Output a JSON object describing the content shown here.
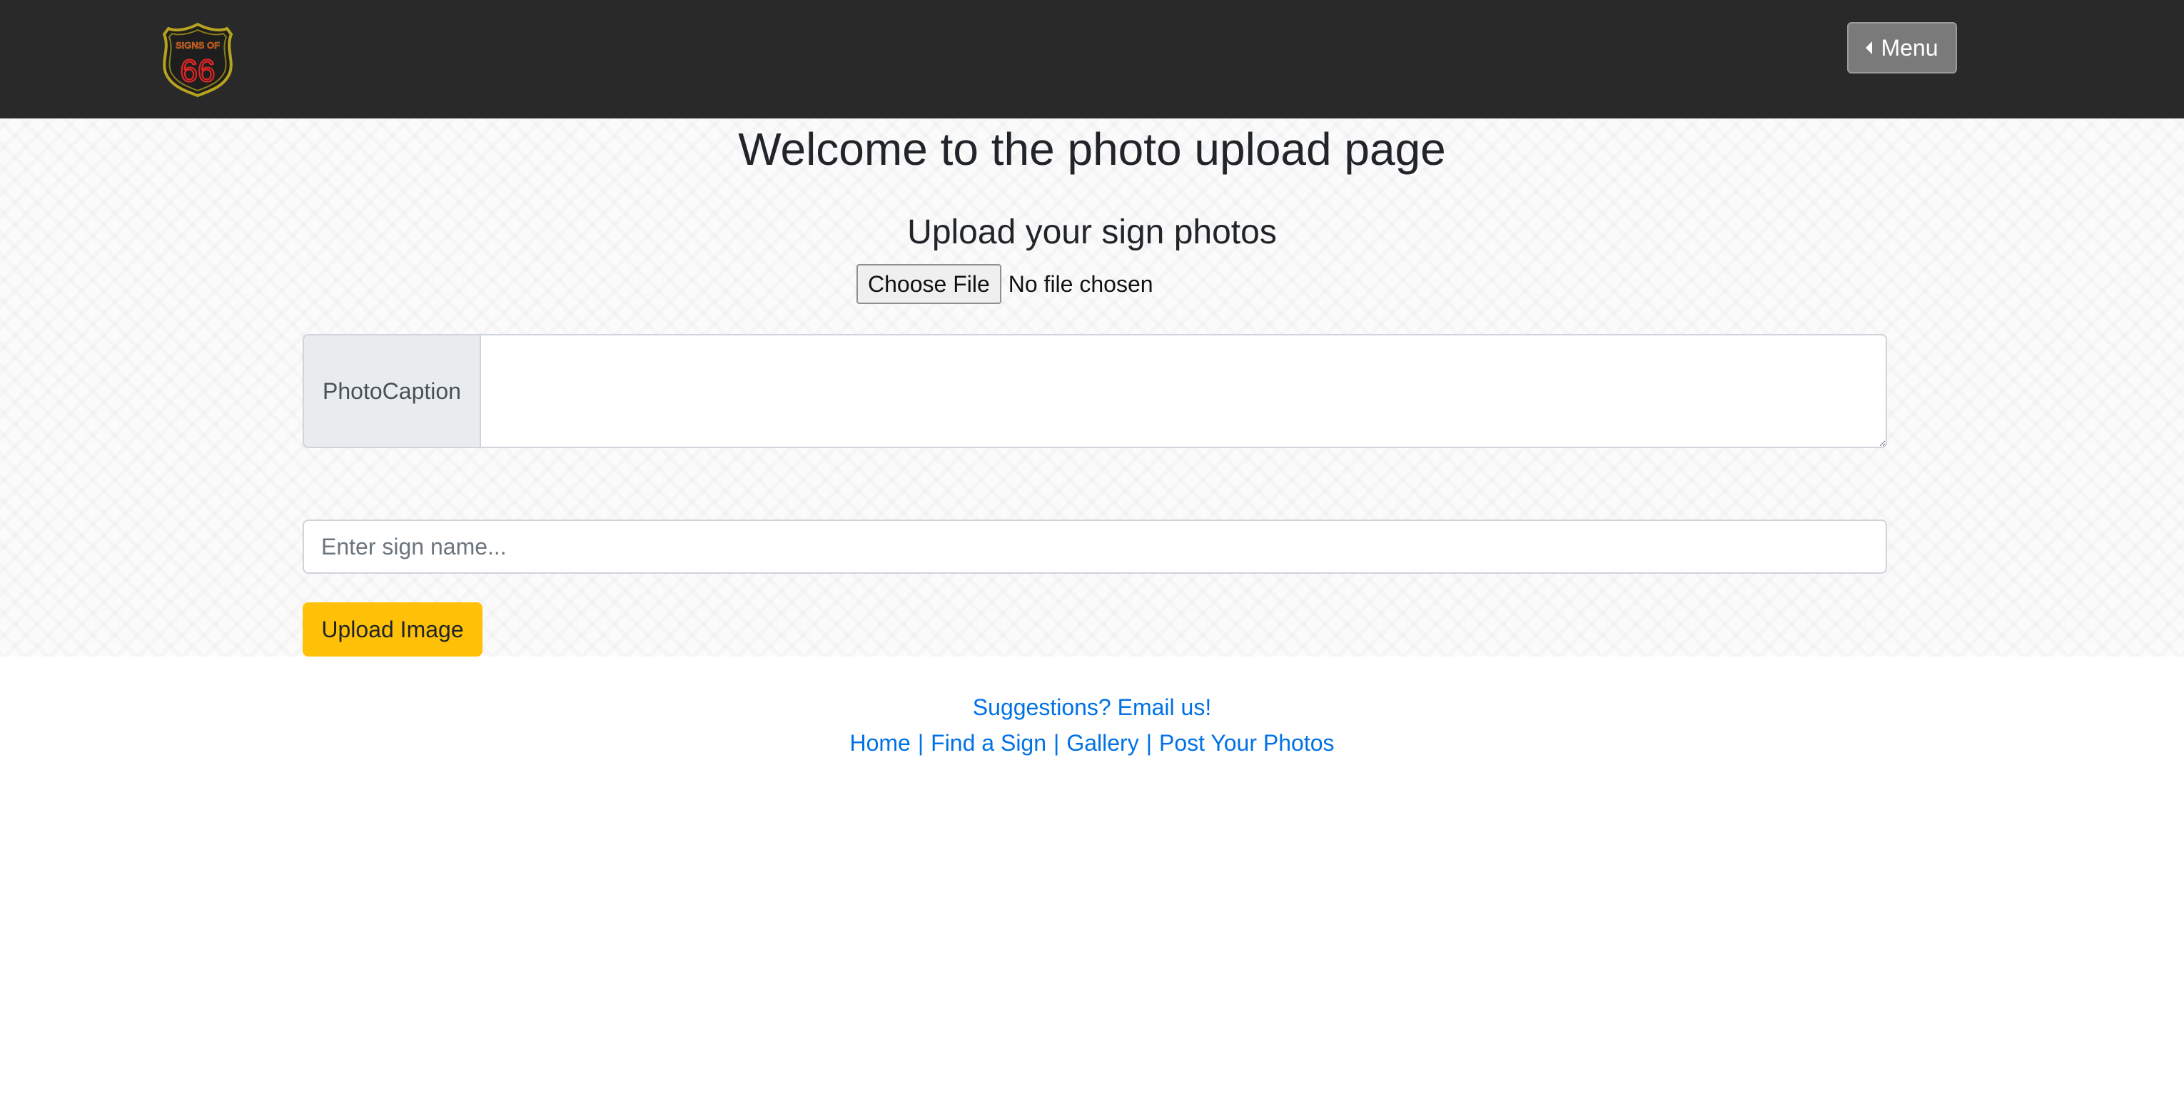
{
  "header": {
    "logo_alt": "Signs of 66",
    "logo_text_top": "SIGNS OF",
    "logo_text_number": "66",
    "menu_label": "Menu"
  },
  "main": {
    "title": "Welcome to the photo upload page",
    "upload_heading": "Upload your sign photos",
    "file_button_label": "Choose File",
    "file_status": "No file chosen",
    "caption_label": "PhotoCaption",
    "caption_value": "",
    "sign_name_placeholder": "Enter sign name...",
    "sign_name_value": "",
    "upload_button_label": "Upload Image"
  },
  "footer": {
    "suggestion_link": "Suggestions? Email us!",
    "nav_links": [
      "Home",
      "Find a Sign",
      "Gallery",
      "Post Your Photos"
    ],
    "separator": "|"
  },
  "colors": {
    "navbar_bg": "#292929",
    "accent": "#ffc107",
    "link": "#0072e5",
    "menu_btn_bg": "#7a7a7a"
  }
}
